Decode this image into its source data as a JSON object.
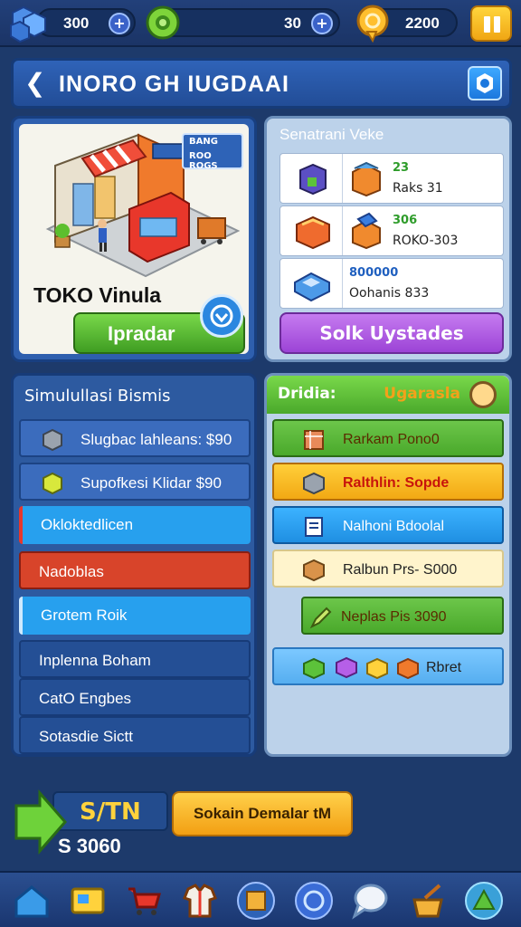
{
  "resources": {
    "gems": "300",
    "gear": "30",
    "coins": "2200"
  },
  "header": {
    "title": "INORO GH IUGDAAI"
  },
  "store": {
    "badge_line1": "BANG",
    "badge_line2": "ROO ROGS",
    "name": "TOKO Vinula",
    "upgrade_label": "Ipradar"
  },
  "stats": {
    "title": "Senatrani Veke",
    "rows": [
      {
        "top": "23",
        "bottom": "Raks 31"
      },
      {
        "top": "306",
        "bottom": "ROKO-303"
      },
      {
        "top": "800000",
        "bottom": "Oohanis 833"
      }
    ],
    "stock_button": "Solk Uystades"
  },
  "simulation": {
    "title": "Simulullasi Bismis",
    "rows": [
      {
        "label": "Slugbac lahleans: $90",
        "style": "light"
      },
      {
        "label": "Supofkesi Klidar  $90",
        "style": "light"
      },
      {
        "label": "Okloktedlicen",
        "style": "blue"
      },
      {
        "label": "Nadoblas",
        "style": "red"
      },
      {
        "label": "Grotem Roik",
        "style": "blue"
      },
      {
        "label": "Inplenna Boham",
        "style": "dark"
      },
      {
        "label": "CatO Engbes",
        "style": "dark"
      },
      {
        "label": "Sotasdie Sictt",
        "style": "dark"
      }
    ]
  },
  "upgrades": {
    "header_left": "Dridia:",
    "header_right": "Ugarasla",
    "rows": [
      {
        "label": "Rarkam Pono0"
      },
      {
        "label": "Ralthlin: Sopde"
      },
      {
        "label": "Nalhoni Bdoolal"
      },
      {
        "label": "Ralbun Prs-  S000"
      },
      {
        "label": "Neplas Pis 3090"
      },
      {
        "label": "Rbret"
      }
    ]
  },
  "bottom": {
    "cash_label": "S/TN",
    "cash_amount": "S 3060",
    "demand_button": "Sokain Demalar tM"
  },
  "colors": {
    "green": "#4aa92b",
    "purple": "#9c43d6",
    "orange": "#f29f13",
    "red": "#d8442a",
    "blue": "#27a0ee"
  }
}
